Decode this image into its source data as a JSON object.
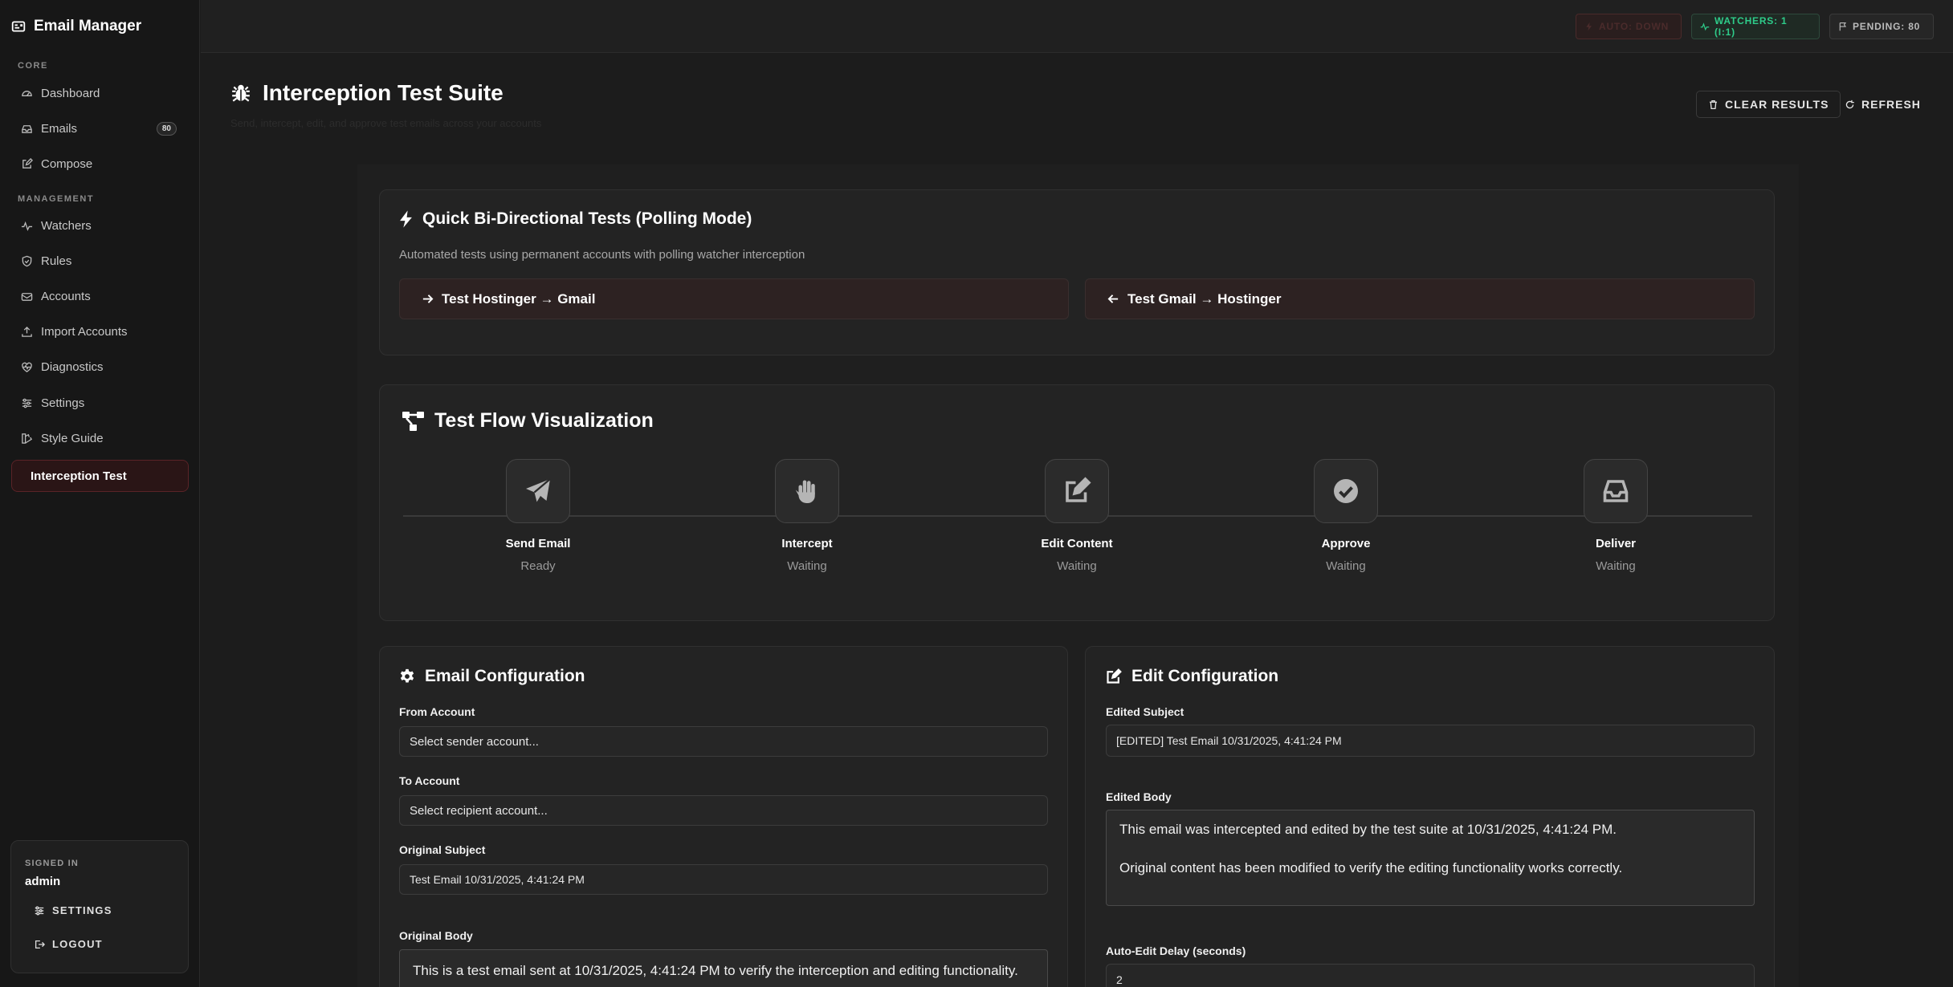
{
  "app": {
    "title": "Email Manager"
  },
  "sidebar": {
    "core_label": "CORE",
    "management_label": "MANAGEMENT",
    "items": [
      {
        "label": "Dashboard",
        "icon": "gauge-icon"
      },
      {
        "label": "Emails",
        "icon": "inbox-icon",
        "badge": "80"
      },
      {
        "label": "Compose",
        "icon": "edit-icon"
      },
      {
        "label": "Watchers",
        "icon": "activity-icon"
      },
      {
        "label": "Rules",
        "icon": "shield-icon"
      },
      {
        "label": "Accounts",
        "icon": "mailbox-icon"
      },
      {
        "label": "Import Accounts",
        "icon": "upload-icon"
      },
      {
        "label": "Diagnostics",
        "icon": "heartbeat-icon"
      },
      {
        "label": "Settings",
        "icon": "sliders-icon"
      },
      {
        "label": "Style Guide",
        "icon": "palette-icon"
      },
      {
        "label": "Interception Test",
        "icon": ""
      }
    ],
    "signed_in_label": "SIGNED IN",
    "user": "admin",
    "settings_label": "SETTINGS",
    "logout_label": "LOGOUT"
  },
  "topbar": {
    "auto_down": "AUTO: DOWN",
    "watchers": "WATCHERS: 1 (I:1)",
    "pending": "PENDING: 80"
  },
  "header": {
    "title": "Interception Test Suite",
    "subtitle": "Send, intercept, edit, and approve test emails across your accounts",
    "clear_results": "CLEAR RESULTS",
    "refresh": "REFRESH"
  },
  "quick_tests": {
    "title": "Quick Bi-Directional Tests (Polling Mode)",
    "description": "Automated tests using permanent accounts with polling watcher interception",
    "btn1": "Test Hostinger → Gmail",
    "btn2": "Test Gmail → Hostinger"
  },
  "flow": {
    "title": "Test Flow Visualization",
    "steps": [
      {
        "name": "Send Email",
        "status": "Ready",
        "icon": "paper-plane-icon"
      },
      {
        "name": "Intercept",
        "status": "Waiting",
        "icon": "hand-icon"
      },
      {
        "name": "Edit Content",
        "status": "Waiting",
        "icon": "edit-icon"
      },
      {
        "name": "Approve",
        "status": "Waiting",
        "icon": "check-circle-icon"
      },
      {
        "name": "Deliver",
        "status": "Waiting",
        "icon": "inbox-icon"
      }
    ]
  },
  "email_config": {
    "title": "Email Configuration",
    "from_label": "From Account",
    "from_value": "Select sender account...",
    "to_label": "To Account",
    "to_value": "Select recipient account...",
    "subject_label": "Original Subject",
    "subject_value": "Test Email 10/31/2025, 4:41:24 PM",
    "body_label": "Original Body",
    "body_value": "This is a test email sent at 10/31/2025, 4:41:24 PM to verify the interception and editing functionality."
  },
  "edit_config": {
    "title": "Edit Configuration",
    "subject_label": "Edited Subject",
    "subject_value": "[EDITED] Test Email 10/31/2025, 4:41:24 PM",
    "body_label": "Edited Body",
    "body_value": "This email was intercepted and edited by the test suite at 10/31/2025, 4:41:24 PM.\n\nOriginal content has been modified to verify the editing functionality works correctly.",
    "delay_label": "Auto-Edit Delay (seconds)",
    "delay_value": "2"
  },
  "colors": {
    "accent_red": "#5a2327",
    "success_green": "#2ecc8a",
    "muted": "#9a9a9a"
  }
}
